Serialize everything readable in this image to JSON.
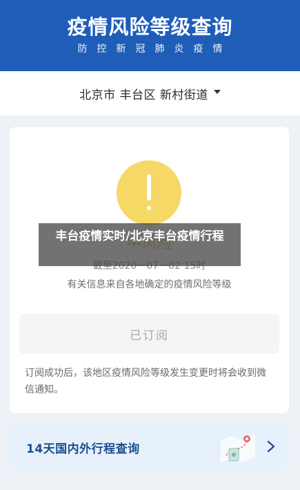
{
  "header": {
    "title": "疫情风险等级查询",
    "subtitle": "防控新冠肺炎疫情"
  },
  "location": {
    "text": "北京市 丰台区 新村街道"
  },
  "status": {
    "risk_level": "中风险",
    "as_of": "截至2020－07－02 15时",
    "source_note": "有关信息来自各地确定的疫情风险等级",
    "subscribed_label": "已订阅",
    "subscribe_note": "订阅成功后，该地区疫情风险等级发生变更时将会收到微信通知。"
  },
  "itinerary": {
    "label": "14天国内外行程查询"
  },
  "overlay": {
    "text": "丰台疫情实时/北京丰台疫情行程"
  },
  "colors": {
    "header_bg": "#1f5db8",
    "alert_yellow": "#f5d865",
    "itinerary_bg": "#e7f1fb"
  }
}
